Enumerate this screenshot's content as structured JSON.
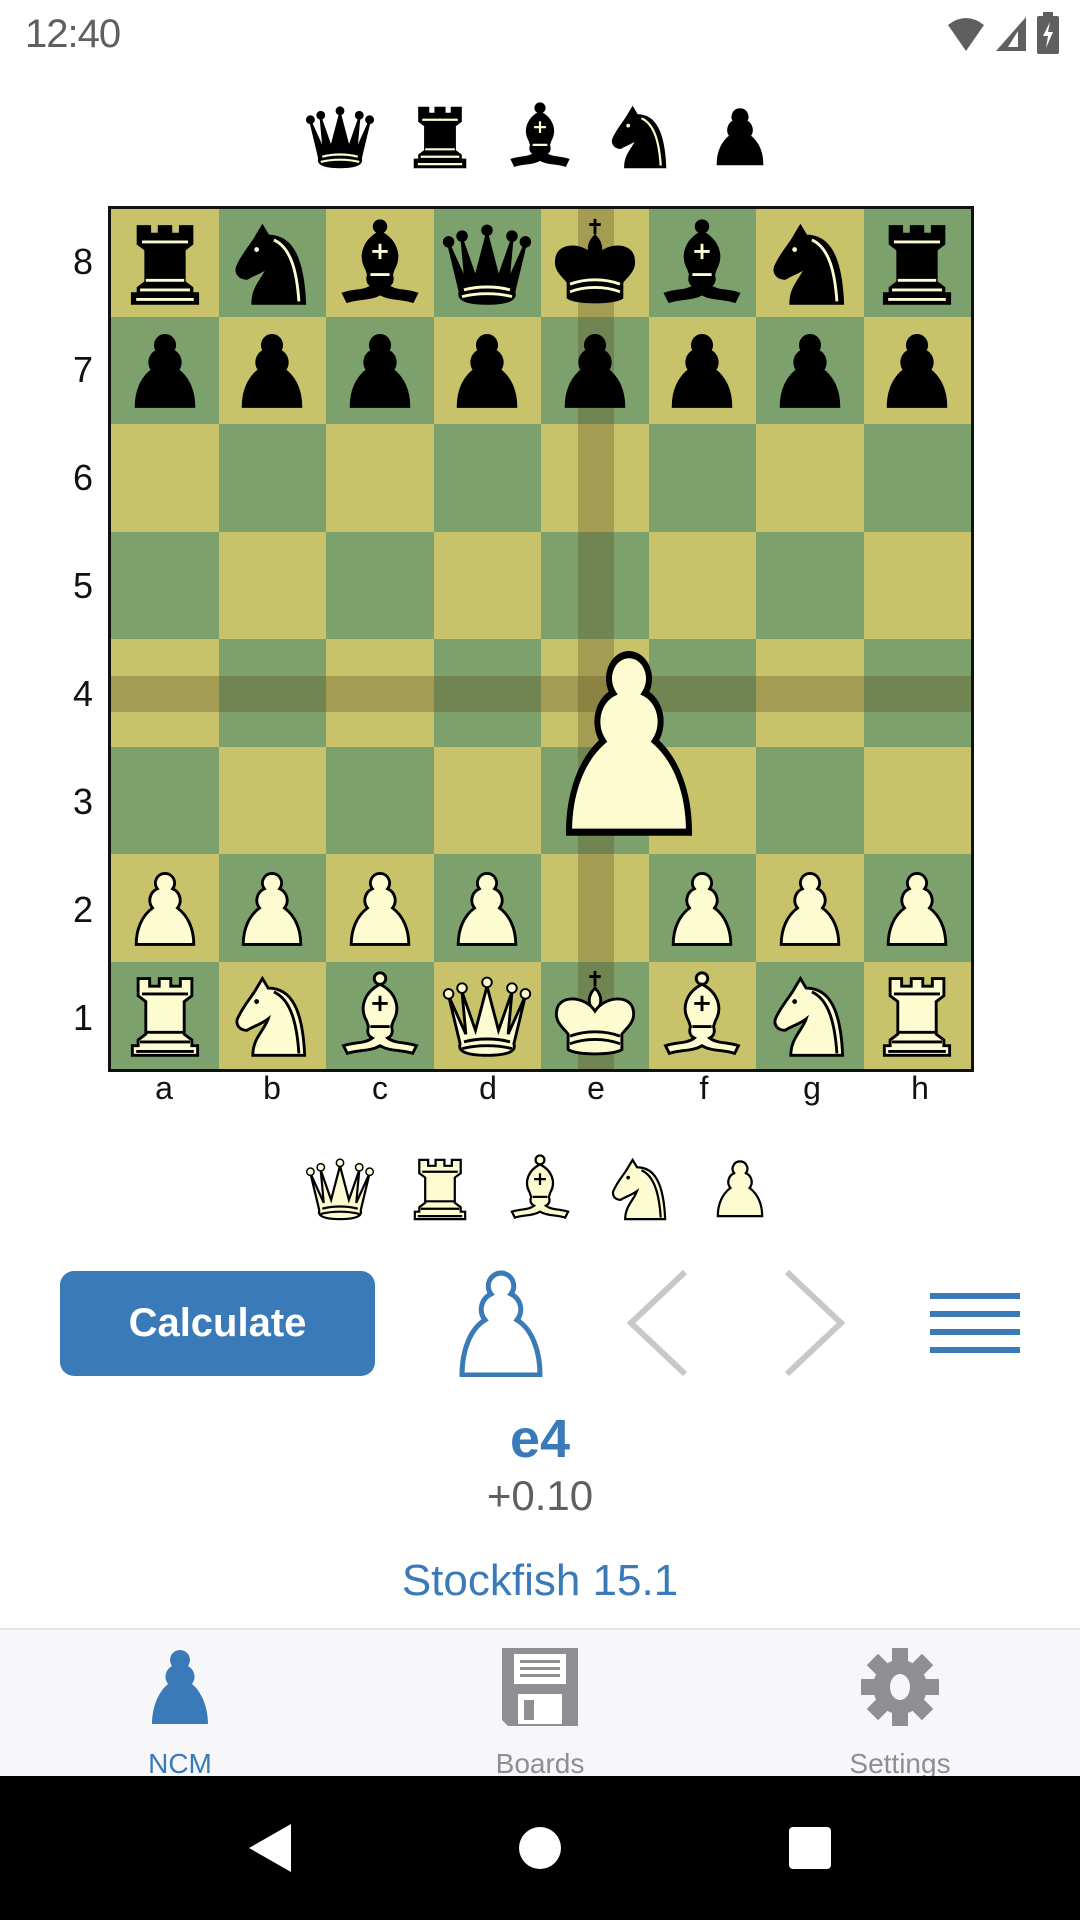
{
  "status_bar": {
    "time": "12:40",
    "icons": [
      "wifi-icon",
      "cell-signal-icon",
      "battery-charging-icon"
    ]
  },
  "captured": {
    "by_white": [
      "q",
      "r",
      "b",
      "n",
      "p"
    ],
    "by_black": [
      "Q",
      "R",
      "B",
      "N",
      "P"
    ]
  },
  "board": {
    "orientation": "white",
    "ranks": [
      "8",
      "7",
      "6",
      "5",
      "4",
      "3",
      "2",
      "1"
    ],
    "files": [
      "a",
      "b",
      "c",
      "d",
      "e",
      "f",
      "g",
      "h"
    ],
    "position": [
      [
        "r",
        "n",
        "b",
        "q",
        "k",
        "b",
        "n",
        "r"
      ],
      [
        "p",
        "p",
        "p",
        "p",
        "p",
        "p",
        "p",
        "p"
      ],
      [
        "",
        "",
        "",
        "",
        "",
        "",
        "",
        ""
      ],
      [
        "",
        "",
        "",
        "",
        "",
        "",
        "",
        ""
      ],
      [
        "",
        "",
        "",
        "",
        "",
        "",
        "",
        ""
      ],
      [
        "",
        "",
        "",
        "",
        "",
        "",
        "",
        ""
      ],
      [
        "P",
        "P",
        "P",
        "P",
        "",
        "P",
        "P",
        "P"
      ],
      [
        "R",
        "N",
        "B",
        "Q",
        "K",
        "B",
        "N",
        "R"
      ]
    ],
    "dragged_piece": "P",
    "drag_target_square": "e4",
    "highlight_file": "e",
    "highlight_rank": "4",
    "light_square_color": "#c8c36a",
    "dark_square_color": "#7da16c"
  },
  "controls": {
    "calculate_label": "Calculate",
    "side_to_move_icon": "white-pawn-outline-icon",
    "prev_icon": "chevron-left-icon",
    "next_icon": "chevron-right-icon",
    "menu_icon": "hamburger-menu-icon"
  },
  "analysis": {
    "best_move": "e4",
    "evaluation": "+0.10",
    "engine": "Stockfish 15.1"
  },
  "bottom_nav": {
    "items": [
      {
        "label": "NCM",
        "icon": "pawn-icon",
        "active": true
      },
      {
        "label": "Boards",
        "icon": "floppy-disk-icon",
        "active": false
      },
      {
        "label": "Settings",
        "icon": "gear-icon",
        "active": false
      }
    ]
  },
  "colors": {
    "accent": "#3a7ab8",
    "inactive": "#8e8e93",
    "disabled": "#c8c8c8"
  }
}
